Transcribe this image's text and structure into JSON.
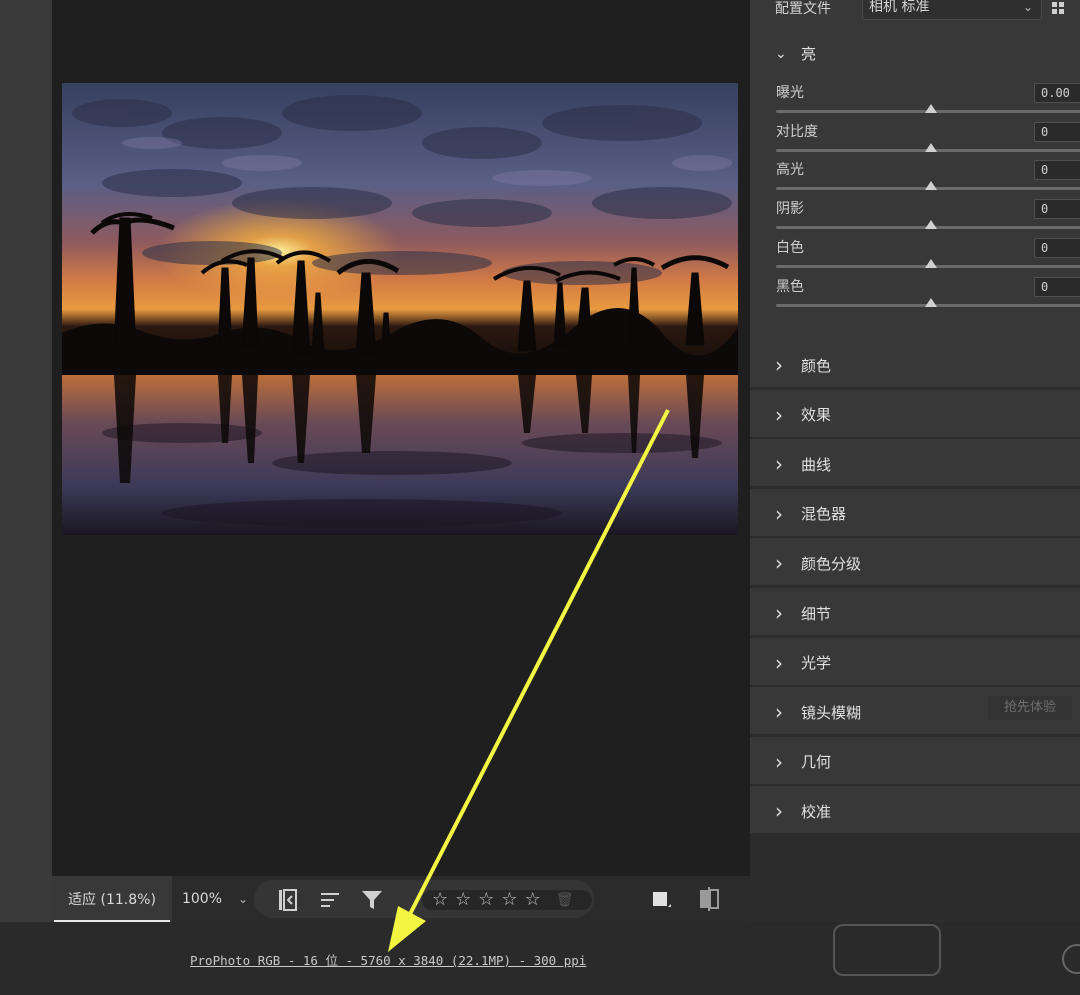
{
  "profile": {
    "label": "配置文件",
    "value": "相机 标准",
    "dropdown_icon": "chevron-down-icon",
    "grid_icon": "grid-icon"
  },
  "light": {
    "title": "亮",
    "sliders": [
      {
        "label": "曝光",
        "value": "0.00",
        "position": 0.5
      },
      {
        "label": "对比度",
        "value": "0",
        "position": 0.5
      },
      {
        "label": "高光",
        "value": "0",
        "position": 0.5
      },
      {
        "label": "阴影",
        "value": "0",
        "position": 0.5
      },
      {
        "label": "白色",
        "value": "0",
        "position": 0.5
      },
      {
        "label": "黑色",
        "value": "0",
        "position": 0.5
      }
    ]
  },
  "sections": [
    {
      "label": "颜色"
    },
    {
      "label": "效果"
    },
    {
      "label": "曲线"
    },
    {
      "label": "混色器"
    },
    {
      "label": "颜色分级"
    },
    {
      "label": "细节"
    },
    {
      "label": "光学"
    },
    {
      "label": "镜头模糊",
      "badge": "抢先体验"
    },
    {
      "label": "几何"
    },
    {
      "label": "校准"
    }
  ],
  "toolbar": {
    "zoom_fit": "适应 (11.8%)",
    "zoom_100": "100%",
    "zoom_dropdown_icon": "chevron-down-icon",
    "stars_count": 5,
    "rating": 0
  },
  "status": {
    "info": "ProPhoto RGB - 16 位 - 5760 x 3840 (22.1MP) - 300 ppi"
  },
  "colors": {
    "annotation_arrow": "#f2f542",
    "panel_bg": "#383838",
    "canvas_bg": "#1f1f1f"
  }
}
